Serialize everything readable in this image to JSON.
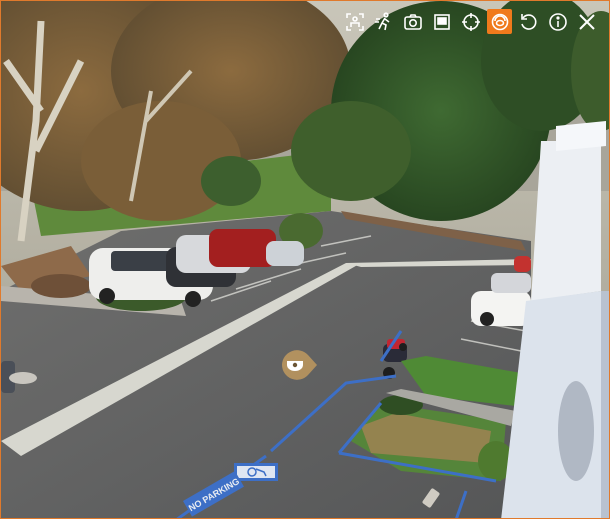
{
  "viewer": {
    "toolbar": [
      {
        "name": "face-detect-icon",
        "label": ""
      },
      {
        "name": "person-tracking-icon",
        "label": ""
      },
      {
        "name": "snapshot-camera-icon",
        "label": ""
      },
      {
        "name": "window-mode-icon",
        "label": ""
      },
      {
        "name": "target-crosshair-icon",
        "label": ""
      },
      {
        "name": "fisheye-dewarp-icon",
        "label": "",
        "active": true
      },
      {
        "name": "refresh-icon",
        "label": ""
      },
      {
        "name": "info-icon",
        "label": ""
      },
      {
        "name": "close-icon",
        "label": ""
      }
    ],
    "accent_color": "#f07a1c",
    "pavement_text": "NO PARKING"
  }
}
